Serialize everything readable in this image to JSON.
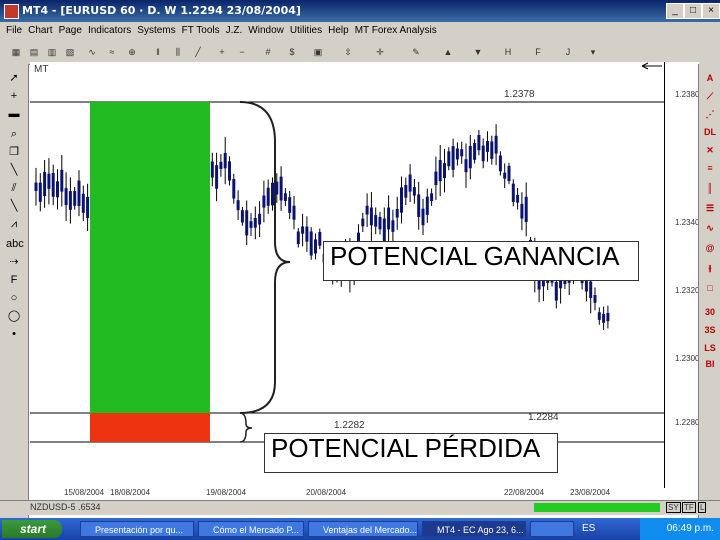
{
  "window": {
    "title": "MT4 - [EURUSD 60 · D. W 1.2294 23/08/2004]",
    "min_icon": "minimize-icon",
    "max_icon": "maximize-icon",
    "close_icon": "close-icon"
  },
  "menu": [
    "File",
    "Chart",
    "Page",
    "Indicators",
    "Systems",
    "FT Tools",
    "J.Z.",
    "Window",
    "Utilities",
    "Help",
    "MT Forex Analysis"
  ],
  "chart": {
    "type": "candlestick",
    "corner_label": "MT",
    "price_high_label": "1.2378",
    "price_low_label": "1.2282",
    "price_low2_label": "1.2284",
    "y_ticks": [
      "1.2380",
      "1.2340",
      "1.2320",
      "1.2300",
      "1.2280"
    ],
    "x_ticks": [
      "15/08/2004",
      "18/08/2004",
      "19/08/2004",
      "20/08/2004",
      "22/08/2004",
      "23/08/2004"
    ],
    "callout_gain": "POTENCIAL GANANCIA",
    "callout_loss": "POTENCIAL PÉRDIDA",
    "colors": {
      "gain_box": "#22bb22",
      "loss_box": "#ee3311",
      "candle": "#0a1470",
      "grid": "#000000"
    }
  },
  "status": {
    "left": "NZDUSD-5 .6534",
    "right_buttons": [
      "SY",
      "TF",
      "L"
    ]
  },
  "taskbar": {
    "start": "start",
    "tasks": [
      "Presentación por qu...",
      "Cómo el Mercado P...",
      "Ventajas del Mercado...",
      "MT4 - EC Ago 23, 6...",
      ""
    ],
    "lang": "ES",
    "clock": "06:49 p.m."
  }
}
